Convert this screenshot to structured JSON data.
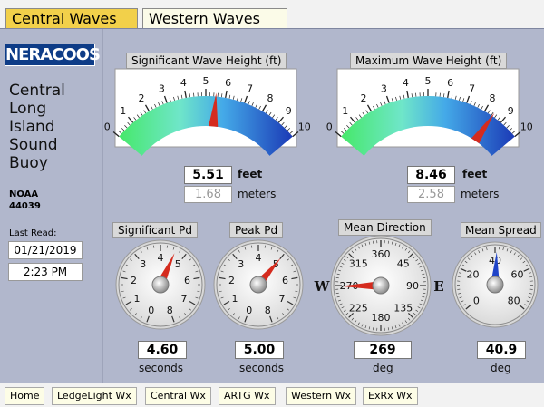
{
  "tabs": {
    "central": "Central Waves",
    "western": "Western Waves"
  },
  "sidebar": {
    "logo": "NERACOOS",
    "buoy_name": "Central Long Island Sound Buoy",
    "agency": "NOAA",
    "station": "44039",
    "last_read_label": "Last Read:",
    "date": "01/21/2019",
    "time": "2:23 PM"
  },
  "sig_wave": {
    "title": "Significant Wave Height (ft)",
    "ticks": [
      "0",
      "1",
      "2",
      "3",
      "4",
      "5",
      "6",
      "7",
      "8",
      "9",
      "10"
    ],
    "value": 5.51,
    "feet": "5.51",
    "feet_unit": "feet",
    "meters": "1.68",
    "meters_unit": "meters"
  },
  "max_wave": {
    "title": "Maximum Wave Height (ft)",
    "ticks": [
      "0",
      "1",
      "2",
      "3",
      "4",
      "5",
      "6",
      "7",
      "8",
      "9",
      "10"
    ],
    "value": 8.46,
    "feet": "8.46",
    "feet_unit": "feet",
    "meters": "2.58",
    "meters_unit": "meters"
  },
  "sig_pd": {
    "title": "Significant Pd",
    "ticks": [
      "0",
      "1",
      "2",
      "3",
      "4",
      "5",
      "6",
      "7",
      "8"
    ],
    "value": 4.6,
    "display": "4.60",
    "unit": "seconds"
  },
  "peak_pd": {
    "title": "Peak Pd",
    "ticks": [
      "0",
      "1",
      "2",
      "3",
      "4",
      "5",
      "6",
      "7",
      "8"
    ],
    "value": 5.0,
    "display": "5.00",
    "unit": "seconds"
  },
  "mean_dir": {
    "title": "Mean Direction",
    "ticks": [
      "360",
      "45",
      "90",
      "135",
      "180",
      "225",
      "270",
      "315"
    ],
    "west_label": "W",
    "east_label": "E",
    "value": 269,
    "display": "269",
    "unit": "deg"
  },
  "mean_spread": {
    "title": "Mean Spread",
    "ticks": [
      "0",
      "20",
      "40",
      "60",
      "80"
    ],
    "value": 40.9,
    "display": "40.9",
    "unit": "deg"
  },
  "nav": [
    "Home",
    "LedgeLight Wx",
    "Central Wx",
    "ARTG Wx",
    "Western Wx",
    "ExRx Wx"
  ],
  "colors": {
    "panel": "#b1b7cc",
    "tab_active": "#f2d04a",
    "needle_red": "#d52b1e",
    "needle_blue": "#1f44c8",
    "logo": "#0e3c87"
  }
}
